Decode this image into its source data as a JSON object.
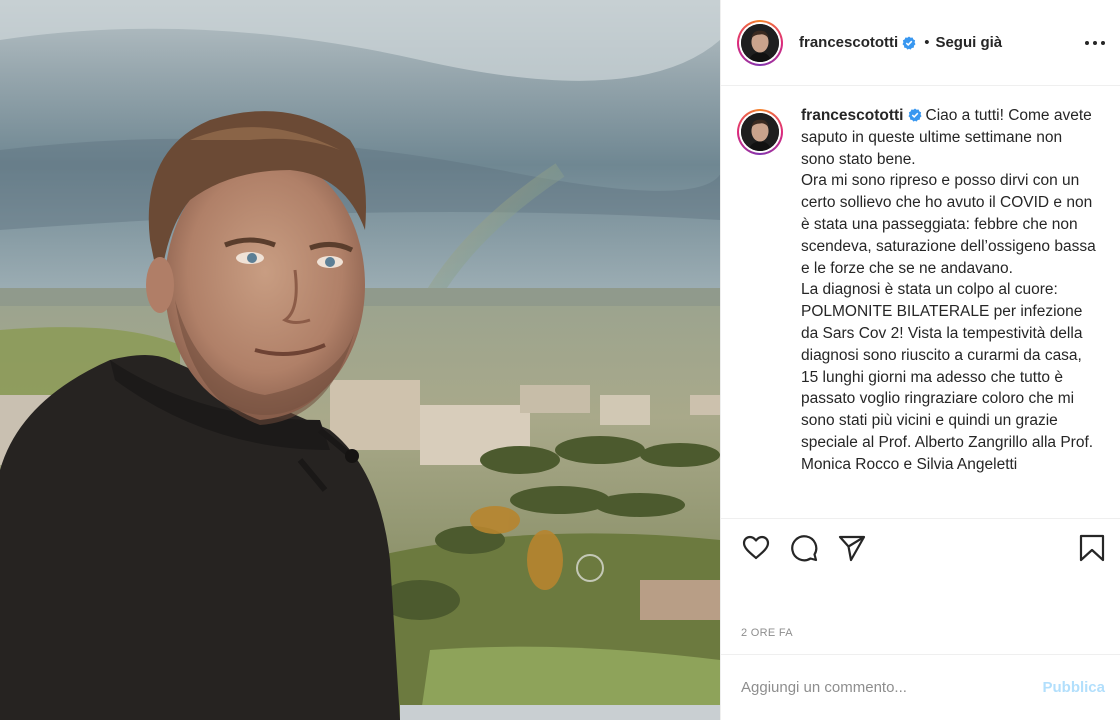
{
  "post": {
    "username": "francescototti",
    "verified": true,
    "follow_status": "Segui già",
    "separator": "•"
  },
  "caption": {
    "text": "Ciao a tutti! Come avete saputo in queste ultime settimane non sono stato bene.\nOra mi sono ripreso e posso dirvi con un certo sollievo che ho avuto il COVID e non è stata una passeggiata: febbre che non scendeva, saturazione dell’ossigeno bassa e le forze che se ne andavano.\nLa diagnosi è stata un colpo al cuore: POLMONITE BILATERALE per infezione da Sars Cov 2! Vista la tempestività della diagnosi sono riuscito a curarmi da casa, 15 lunghi giorni ma adesso che tutto è passato voglio ringraziare coloro che mi sono stati più vicini e quindi un grazie speciale al Prof. Alberto Zangrillo alla Prof. Monica Rocco e Silvia Angeletti"
  },
  "actions": {
    "like_icon": "heart-icon",
    "comment_icon": "comment-icon",
    "share_icon": "paper-plane-icon",
    "save_icon": "bookmark-icon"
  },
  "timestamp": "2 ORE FA",
  "comment": {
    "placeholder": "Aggiungi un commento...",
    "publish_label": "Pubblica"
  },
  "colors": {
    "verified_blue": "#3897f0",
    "publish_disabled": "#b2dffc",
    "muted_text": "#8e8e8e",
    "story_ring": "#dd2a7b"
  }
}
